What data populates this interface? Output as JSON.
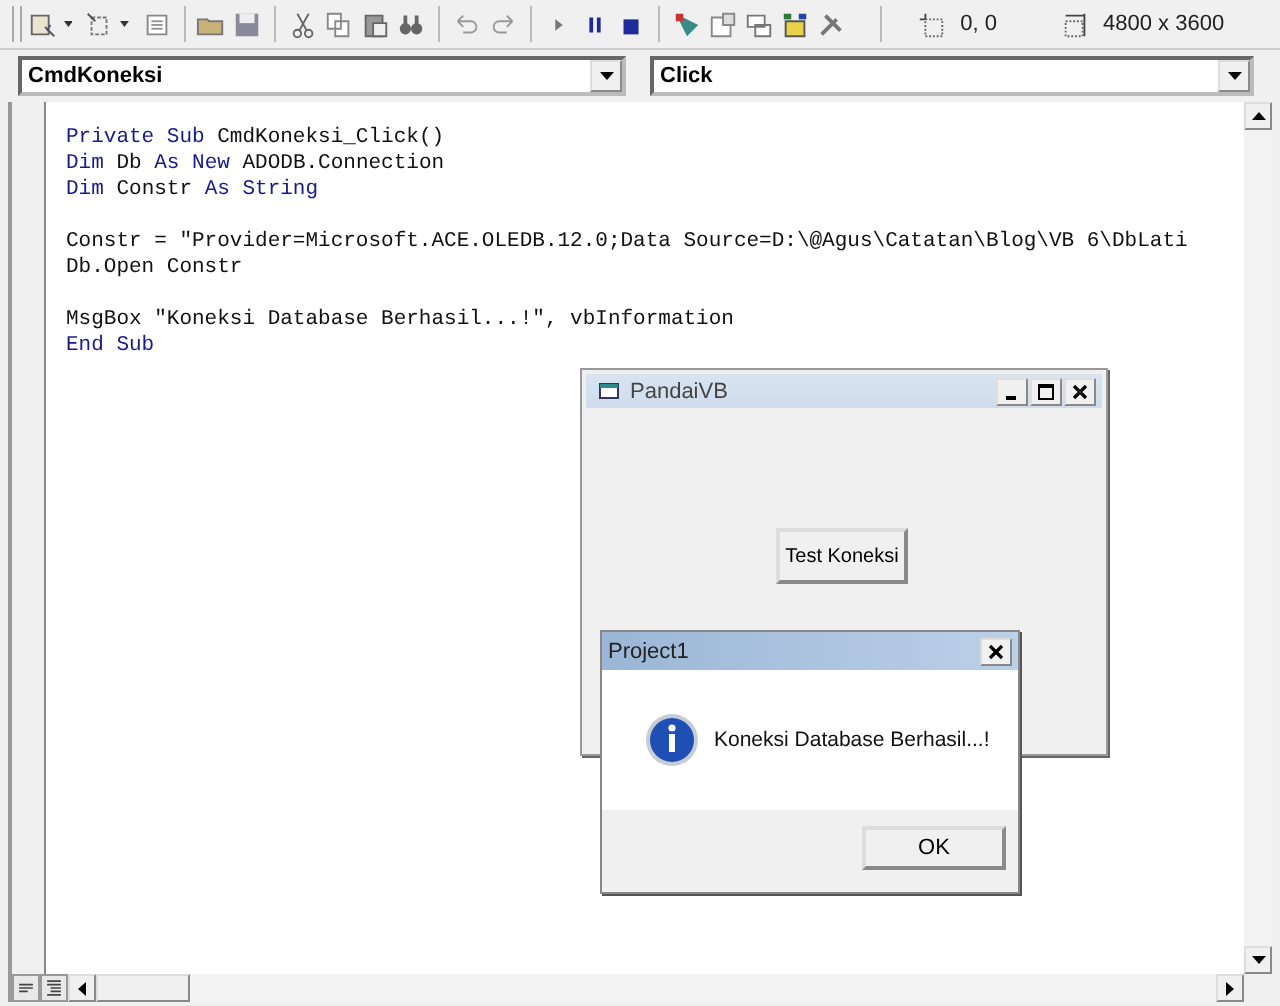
{
  "toolbar": {
    "position": "0, 0",
    "size": "4800 x 3600"
  },
  "object_combo": {
    "value": "CmdKoneksi"
  },
  "procedure_combo": {
    "value": "Click"
  },
  "code_blocks": [
    [
      [
        {
          "kind": "keyword",
          "text": "Private Sub "
        },
        {
          "kind": "text",
          "text": "CmdKoneksi_Click()"
        }
      ],
      [
        {
          "kind": "keyword",
          "text": "Dim "
        },
        {
          "kind": "text",
          "text": "Db "
        },
        {
          "kind": "keyword",
          "text": "As New "
        },
        {
          "kind": "text",
          "text": "ADODB.Connection"
        }
      ],
      [
        {
          "kind": "keyword",
          "text": "Dim "
        },
        {
          "kind": "text",
          "text": "Constr "
        },
        {
          "kind": "keyword",
          "text": "As String"
        }
      ]
    ],
    [
      [
        {
          "kind": "text",
          "text": "Constr = \"Provider=Microsoft.ACE.OLEDB.12.0;Data Source=D:\\@Agus\\Catatan\\Blog\\VB 6\\DbLati"
        }
      ],
      [
        {
          "kind": "text",
          "text": "Db.Open Constr"
        }
      ]
    ],
    [
      [
        {
          "kind": "text",
          "text": "MsgBox \"Koneksi Database Berhasil...!\", vbInformation"
        }
      ],
      [
        {
          "kind": "keyword",
          "text": "End Sub"
        }
      ]
    ]
  ],
  "form_window": {
    "title": "PandaiVB",
    "button": "Test Koneksi"
  },
  "message_box": {
    "title": "Project1",
    "message": "Koneksi Database Berhasil...!",
    "button": "OK"
  }
}
